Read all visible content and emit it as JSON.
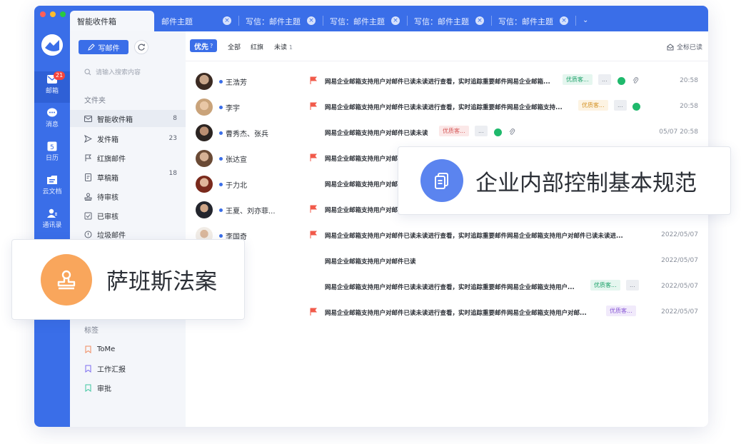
{
  "tabs": [
    {
      "label": "智能收件箱",
      "active": true
    },
    {
      "label": "邮件主题"
    },
    {
      "label": "写信：邮件主题"
    },
    {
      "label": "写信：邮件主题"
    },
    {
      "label": "写信：邮件主题"
    },
    {
      "label": "写信：邮件主题"
    }
  ],
  "tab_close_glyph": "×",
  "tab_more_glyph": "⌄",
  "rail": {
    "items": [
      {
        "label": "邮箱",
        "icon": "mail-icon",
        "badge": "21"
      },
      {
        "label": "消息",
        "icon": "chat-icon"
      },
      {
        "label": "日历",
        "icon": "calendar-icon",
        "icon_text": "5"
      },
      {
        "label": "云文档",
        "icon": "cloud-doc-icon"
      },
      {
        "label": "通讯录",
        "icon": "contacts-icon"
      }
    ]
  },
  "sidebar": {
    "compose_label": "写邮件",
    "search_placeholder": "请输入搜索内容",
    "folders_title": "文件夹",
    "folders": [
      {
        "label": "智能收件箱",
        "count": "8",
        "icon": "inbox-icon"
      },
      {
        "label": "发件箱",
        "count": "23",
        "icon": "send-icon"
      },
      {
        "label": "红旗邮件",
        "count": "",
        "icon": "flag-icon"
      },
      {
        "label": "草稿箱",
        "count": "18",
        "icon": "draft-icon"
      },
      {
        "label": "待审核",
        "count": "",
        "icon": "stamp-icon"
      },
      {
        "label": "已审核",
        "count": "",
        "icon": "check-icon"
      },
      {
        "label": "垃圾邮件",
        "count": "",
        "icon": "spam-icon"
      }
    ],
    "tags_title": "标签",
    "tags": [
      {
        "label": "ToMe",
        "color": "#f08a5d"
      },
      {
        "label": "工作汇报",
        "color": "#7b6cf0"
      },
      {
        "label": "审批",
        "color": "#3fc6a0"
      }
    ]
  },
  "filters": {
    "priority_label": "优先",
    "priority_help": "?",
    "all": "全部",
    "flagged": "红旗",
    "unread": "未读",
    "unread_count": "1",
    "mark_all_read": "全标已读"
  },
  "mails": [
    {
      "sender": "王浩芳",
      "flag": true,
      "subject": "网易企业邮箱支持用户对邮件已读未读进行查看，实时追踪重要邮件网易企业邮箱...",
      "tag": "优质客...",
      "tag_color": "green",
      "more": "...",
      "wechat": true,
      "attach": true,
      "time": "20:58"
    },
    {
      "sender": "李宇",
      "flag": true,
      "subject": "网易企业邮箱支持用户对邮件已读未读进行查看，实时追踪重要邮件网易企业邮箱支持...",
      "tag": "优质客...",
      "tag_color": "yellow",
      "more": "...",
      "wechat": true,
      "attach": false,
      "time": "20:58"
    },
    {
      "sender": "曹秀杰、张兵",
      "flag": false,
      "subject": "网易企业邮箱支持用户对邮件已读未读",
      "tag": "优质客...",
      "tag_color": "red",
      "more": "...",
      "wechat": true,
      "attach": true,
      "time": "05/07 20:58"
    },
    {
      "sender": "张达宣",
      "flag": true,
      "subject": "网易企业邮箱支持用户对邮",
      "tag": "",
      "more": "",
      "wechat": false,
      "attach": false,
      "time": ""
    },
    {
      "sender": "于力北",
      "flag": false,
      "subject": "网易企业邮箱支持用户对邮",
      "tag": "",
      "more": "",
      "wechat": false,
      "attach": false,
      "time": ""
    },
    {
      "sender": "王夏、刘亦菲...",
      "flag": true,
      "subject": "网易企业邮箱支持用户对邮",
      "tag": "",
      "more": "",
      "wechat": false,
      "attach": false,
      "time": ""
    },
    {
      "sender": "李国奇",
      "flag": true,
      "subject": "网易企业邮箱支持用户对邮件已读未读进行查看，实时追踪重要邮件网易企业邮箱支持用户对邮件已读未读进...",
      "tag": "",
      "more": "",
      "wechat": false,
      "attach": false,
      "time": "2022/05/07"
    },
    {
      "sender": "",
      "flag": false,
      "subject": "网易企业邮箱支持用户对邮件已读",
      "tag": "",
      "more": "",
      "wechat": false,
      "attach": false,
      "time": "2022/05/07"
    },
    {
      "sender": "",
      "flag": false,
      "subject": "网易企业邮箱支持用户对邮件已读未读进行查看，实时追踪重要邮件网易企业邮箱支持用户...",
      "tag": "优质客...",
      "tag_color": "green",
      "more": "...",
      "wechat": false,
      "attach": false,
      "time": "2022/05/07"
    },
    {
      "sender": "",
      "flag": true,
      "subject": "网易企业邮箱支持用户对邮件已读未读进行查看，实时追踪重要邮件网易企业邮箱支持用户对邮...",
      "tag": "优质客...",
      "tag_color": "purple",
      "more": "",
      "wechat": false,
      "attach": false,
      "time": "2022/05/07"
    }
  ],
  "cards": {
    "control": {
      "text": "企业内部控制基本规范",
      "icon": "copy-doc-icon",
      "color": "#5b84ef"
    },
    "sox": {
      "text": "萨班斯法案",
      "icon": "stamp-icon",
      "color": "#f9a65c"
    }
  },
  "colors": {
    "brand": "#3a6ee8",
    "flag": "#f15a4a",
    "wechat": "#1fb96c"
  }
}
